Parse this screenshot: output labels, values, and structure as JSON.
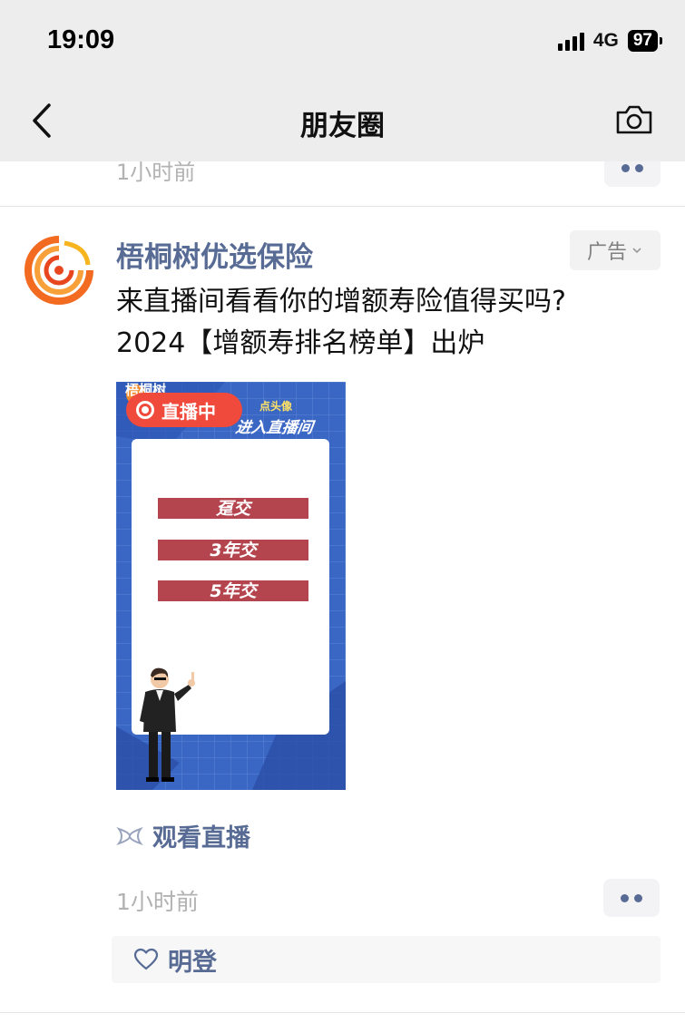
{
  "status_bar": {
    "time": "19:09",
    "network": "4G",
    "battery": "97"
  },
  "nav": {
    "title": "朋友圈"
  },
  "previous_post": {
    "time": "1小时前"
  },
  "post": {
    "author": "梧桐树优选保险",
    "ad_label": "广告",
    "text_line1": "来直播间看看你的增额寿险值得买吗?",
    "text_line2": "2024【增额寿排名榜单】出炉",
    "image": {
      "brand": "梧桐树",
      "live_badge": "直播中",
      "enter_hint": "点头像",
      "enter_text": "进入直播间",
      "options": [
        "趸交",
        "3年交",
        "5年交"
      ]
    },
    "watch_live_label": "观看直播",
    "time": "1小时前",
    "likes": [
      "明登"
    ]
  },
  "colors": {
    "link": "#576b95",
    "live_red": "#f04a3c",
    "bar_red": "#b4444e",
    "image_blue": "#3a66c4"
  }
}
